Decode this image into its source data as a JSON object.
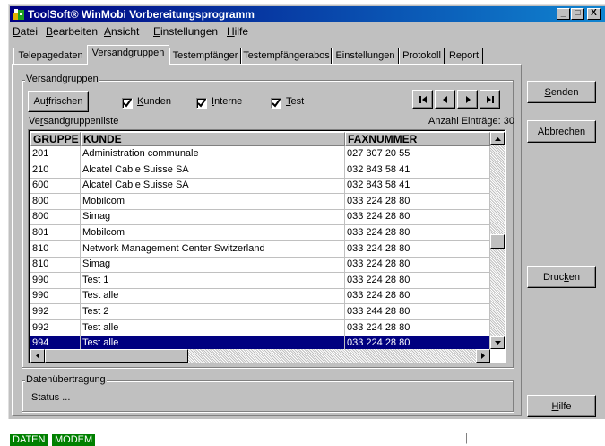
{
  "window": {
    "title": "ToolSoft® WinMobi Vorbereitungsprogramm",
    "controls": {
      "minimize": "_",
      "maximize": "□",
      "close": "X"
    }
  },
  "menu": [
    {
      "pre": "",
      "key": "D",
      "post": "atei"
    },
    {
      "pre": "",
      "key": "B",
      "post": "earbeiten"
    },
    {
      "pre": "",
      "key": "A",
      "post": "nsicht"
    },
    {
      "pre": "",
      "key": "E",
      "post": "instellungen"
    },
    {
      "pre": "",
      "key": "H",
      "post": "ilfe"
    }
  ],
  "tabs": [
    "Telepagedaten",
    "Versandgruppen",
    "Testempfänger",
    "Testempfängerabos",
    "Einstellungen",
    "Protokoll",
    "Report"
  ],
  "active_tab": "Versandgruppen",
  "versand": {
    "group_label": "Versandgruppen",
    "refresh": {
      "pre": "Au",
      "key": "f",
      "post": "frischen"
    },
    "filters": [
      {
        "pre": "",
        "key": "K",
        "post": "unden",
        "checked": true
      },
      {
        "pre": "",
        "key": "I",
        "post": "nterne",
        "checked": true
      },
      {
        "pre": "",
        "key": "T",
        "post": "est",
        "checked": true
      }
    ],
    "list_label": {
      "pre": "Ve",
      "key": "r",
      "post": "sandgruppenliste"
    },
    "count_label": "Anzahl Einträge: 30",
    "nav_icons": [
      "first-icon",
      "prev-icon",
      "next-icon",
      "last-icon"
    ]
  },
  "table": {
    "columns": [
      "GRUPPE",
      "KUNDE",
      "FAXNUMMER"
    ],
    "rows": [
      [
        "201",
        "Administration communale",
        "027 307 20 55"
      ],
      [
        "210",
        "Alcatel Cable Suisse SA",
        "032 843 58 41"
      ],
      [
        "600",
        "Alcatel Cable Suisse SA",
        "032 843 58 41"
      ],
      [
        "800",
        "Mobilcom",
        "033 224 28 80"
      ],
      [
        "800",
        "Simag",
        "033 224 28 80"
      ],
      [
        "801",
        "Mobilcom",
        "033 224 28 80"
      ],
      [
        "810",
        "Network Management Center Switzerland",
        "033 224 28 80"
      ],
      [
        "810",
        "Simag",
        "033 224 28 80"
      ],
      [
        "990",
        "Test 1",
        "033 224 28 80"
      ],
      [
        "990",
        "Test alle",
        "033 224 28 80"
      ],
      [
        "992",
        "Test 2",
        "033 244 28 80"
      ],
      [
        "992",
        "Test alle",
        "033 224 28 80"
      ],
      [
        "994",
        "Test alle",
        "033 224 28 80"
      ]
    ],
    "selected_row": 12
  },
  "transfer": {
    "group_label": "Datenübertragung",
    "status": "Status ..."
  },
  "buttons": {
    "send": {
      "pre": "",
      "key": "S",
      "post": "enden"
    },
    "cancel": {
      "pre": "A",
      "key": "b",
      "post": "brechen"
    },
    "print": {
      "pre": "Druc",
      "key": "k",
      "post": "en"
    },
    "help": {
      "pre": "",
      "key": "H",
      "post": "ilfe"
    }
  },
  "statusbar": {
    "daten": "DATEN",
    "modem": "MODEM"
  },
  "colors": {
    "titlebar": "#000080",
    "selection": "#000080",
    "status_green": "#008000",
    "face": "#c0c0c0"
  }
}
